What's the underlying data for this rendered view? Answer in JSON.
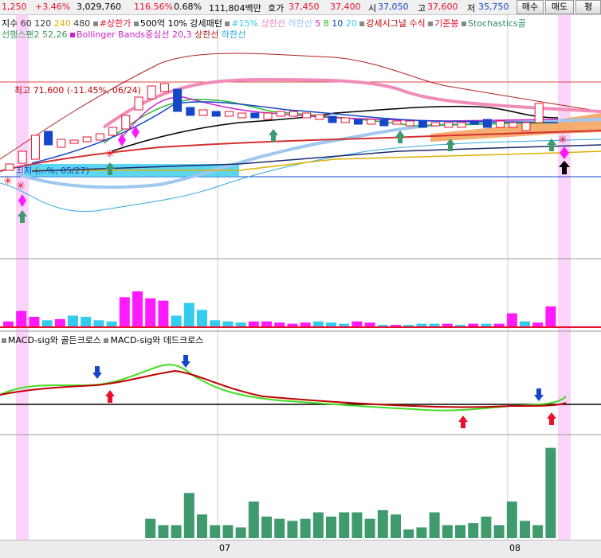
{
  "topbar": {
    "change": "1,250",
    "change_pct": "+3.46%",
    "volume": "3,029,760",
    "volume_ratio": "116.56%",
    "turnover": "0.68%",
    "amount": "111,804백만",
    "quote_label": "호가",
    "ask": "37,450",
    "bid": "37,400",
    "open_label": "시",
    "open": "37,050",
    "high_label": "고",
    "high": "37,600",
    "low_label": "저",
    "low": "35,750",
    "buy_button": "매수",
    "sell_button": "매도",
    "eval_button": "평"
  },
  "legend1": {
    "label": "지수",
    "ma60": "60",
    "ma120": "120",
    "ma240": "240",
    "ma480": "480",
    "upper_limit": "#상한가",
    "pattern": "500억 10% 강세패턴",
    "pct15": "#15%",
    "upper_line": "상한선",
    "lower_line": "하한선",
    "n5": "5",
    "n8": "8",
    "n10": "10",
    "n20": "20",
    "signal": "강세시그널 수식",
    "base_candle": "기준봉",
    "stoch": "Stochastics골"
  },
  "legend2": {
    "span": "선행스팬2 52,26",
    "bb": "Bollinger Bands중심선 20,3",
    "bb_upper": "상한선",
    "bb_lower": "하한선"
  },
  "annotations": {
    "high_label": "최고 71,600 (-11.45%, 06/24)",
    "low_label": "최저 (...%, 05/27)"
  },
  "macd_legend": {
    "golden": "MACD-sig와 골든크로스",
    "dead": "MACD-sig와 데드크로스"
  },
  "date_axis": {
    "label1": "07",
    "label2": "08"
  },
  "colors": {
    "up": "#e8112d",
    "down": "#1646c8",
    "magenta": "#ff1aff",
    "cyan": "#33ccee",
    "green_arrow": "#3f9a6e",
    "macd": "#44dd22",
    "signal": "#c00000",
    "pink_band": "#fbc8f8"
  },
  "chart_data": {
    "type": "candlestick",
    "price_high_label": "71,600",
    "volume": [
      [
        5,
        "m"
      ],
      [
        14,
        "m"
      ],
      [
        9,
        "m"
      ],
      [
        6,
        "c"
      ],
      [
        7,
        "m"
      ],
      [
        10,
        "c"
      ],
      [
        9,
        "c"
      ],
      [
        6,
        "c"
      ],
      [
        5,
        "c"
      ],
      [
        26,
        "m"
      ],
      [
        31,
        "m"
      ],
      [
        25,
        "m"
      ],
      [
        23,
        "m"
      ],
      [
        10,
        "c"
      ],
      [
        21,
        "c"
      ],
      [
        15,
        "c"
      ],
      [
        6,
        "c"
      ],
      [
        5,
        "c"
      ],
      [
        4,
        "c"
      ],
      [
        5,
        "m"
      ],
      [
        5,
        "m"
      ],
      [
        4,
        "m"
      ],
      [
        3,
        "m"
      ],
      [
        4,
        "m"
      ],
      [
        5,
        "c"
      ],
      [
        4,
        "c"
      ],
      [
        3,
        "c"
      ],
      [
        5,
        "m"
      ],
      [
        4,
        "m"
      ],
      [
        2,
        "c"
      ],
      [
        2,
        "m"
      ],
      [
        2,
        "c"
      ],
      [
        3,
        "c"
      ],
      [
        3,
        "c"
      ],
      [
        3,
        "m"
      ],
      [
        2,
        "c"
      ],
      [
        3,
        "m"
      ],
      [
        3,
        "c"
      ],
      [
        3,
        "m"
      ],
      [
        12,
        "m"
      ],
      [
        5,
        "c"
      ],
      [
        4,
        "m"
      ],
      [
        18,
        "m"
      ]
    ],
    "volume2": [
      0,
      0,
      0,
      0,
      0,
      0,
      0,
      0,
      0,
      0,
      0,
      9,
      6,
      6,
      21,
      11,
      6,
      6,
      5,
      17,
      10,
      9,
      8,
      9,
      12,
      10,
      12,
      12,
      9,
      13,
      11,
      4,
      5,
      12,
      6,
      6,
      7,
      10,
      6,
      17,
      8,
      6,
      42
    ]
  }
}
